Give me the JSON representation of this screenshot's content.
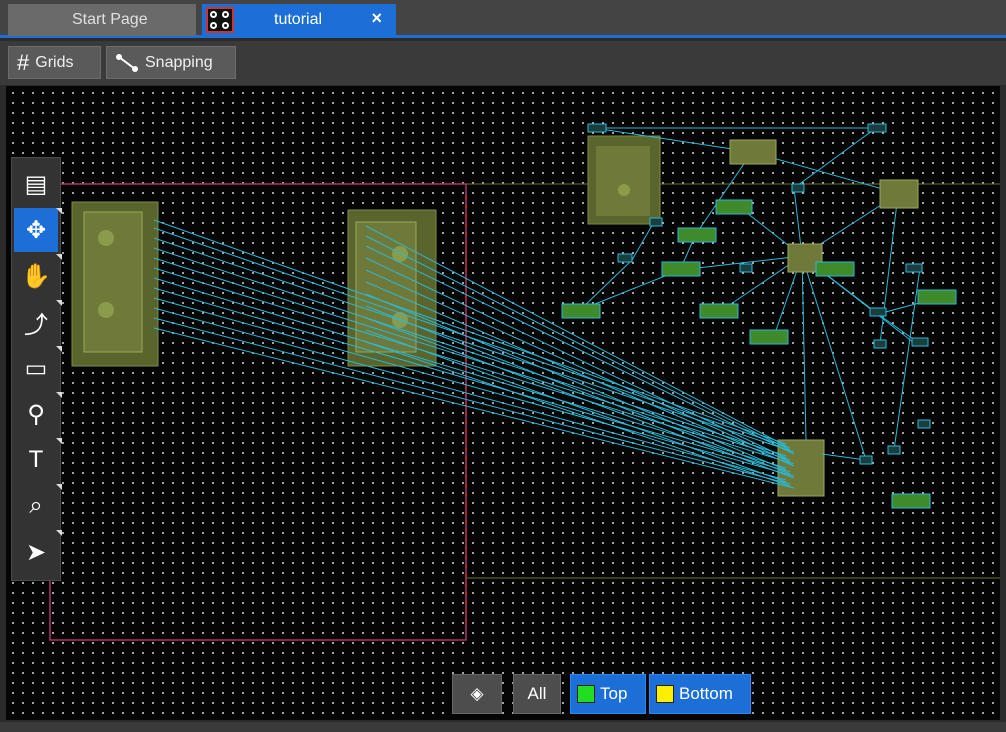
{
  "tabs": [
    {
      "label": "Start Page",
      "active": false
    },
    {
      "label": "tutorial",
      "active": true,
      "close": "×"
    }
  ],
  "toolbar": {
    "grids_label": "Grids",
    "snapping_label": "Snapping"
  },
  "palette": {
    "tools": [
      {
        "name": "comment-icon",
        "glyph": "▤"
      },
      {
        "name": "move-icon",
        "glyph": "✥",
        "active": true
      },
      {
        "name": "hand-icon",
        "glyph": "✋"
      },
      {
        "name": "route-icon",
        "glyph": "⤴"
      },
      {
        "name": "add-component-icon",
        "glyph": "▭"
      },
      {
        "name": "connect-icon",
        "glyph": "⚲"
      },
      {
        "name": "add-text-icon",
        "glyph": "T"
      },
      {
        "name": "zoom-icon",
        "glyph": "⌕"
      },
      {
        "name": "select-arrow-icon",
        "glyph": "➤"
      }
    ]
  },
  "layers": {
    "layers_icon": "layers-icon",
    "all_label": "All",
    "top_label": "Top",
    "bottom_label": "Bottom",
    "top_color": "#22dd22",
    "bottom_color": "#ffee00"
  },
  "colors": {
    "accent": "#1c6fd6",
    "ratsnest": "#29b9d6",
    "footprint": "#6f7a3a",
    "board_outline": "#b0346a"
  }
}
